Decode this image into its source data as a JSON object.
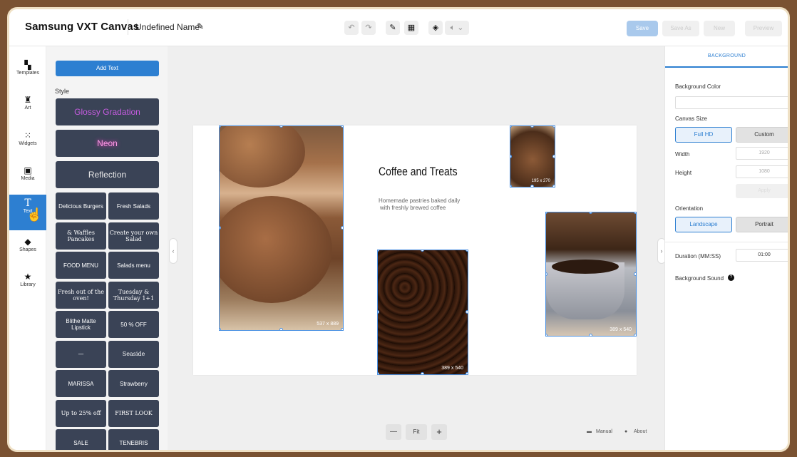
{
  "header": {
    "brand": "Samsung VXT Canvas",
    "project_name": "Undefined Name",
    "buttons": {
      "save": "Save",
      "save_as": "Save As",
      "new": "New",
      "preview": "Preview"
    }
  },
  "colors": {
    "accent": "#2d7fd1",
    "card_bg": "#3a4356",
    "frame": "#7a5232"
  },
  "icons": [
    "undo-icon",
    "redo-icon",
    "mode-edit-icon",
    "layout-icon",
    "layers-icon",
    "volume-icon",
    "pencil-icon"
  ],
  "nav": [
    {
      "label": "Templates"
    },
    {
      "label": "Art"
    },
    {
      "label": "Widgets"
    },
    {
      "label": "Media"
    },
    {
      "label": "Text"
    },
    {
      "label": "Shapes"
    },
    {
      "label": "Library"
    }
  ],
  "panel": {
    "add_text": "Add Text",
    "style_label": "Style",
    "styles_full": [
      "Glossy Gradation",
      "Neon",
      "Reflection"
    ],
    "styles_half": [
      [
        "Delicious Burgers",
        "Fresh Salads"
      ],
      [
        "& Waffles Pancakes",
        "Create your own Salad"
      ],
      [
        "FOOD MENU",
        "Salads menu"
      ],
      [
        "Fresh out of the oven!",
        "Tuesday & Thursday 1+1"
      ],
      [
        "Blithe Matte Lipstick",
        "50 % OFF"
      ],
      [
        "—",
        "Seaside"
      ],
      [
        "MARISSA",
        "Strawberry"
      ],
      [
        "Up to 25% off",
        "FIRST LOOK"
      ],
      [
        "SALE",
        "TENEBRIS"
      ]
    ]
  },
  "canvas": {
    "heading": "Coffee and Treats",
    "subtext1": "Homemade pastries baked daily",
    "subtext2": "with freshly brewed coffee",
    "size_muffin": "537 x 889",
    "size_small": "195 x 270",
    "size_beans": "389 x 540",
    "size_cup": "389 x 540"
  },
  "zoom": {
    "fit": "Fit",
    "minus": "—",
    "plus": "+"
  },
  "footer": {
    "manual": "Manual",
    "about": "About"
  },
  "right": {
    "tab": "BACKGROUND",
    "bg_color_label": "Background Color",
    "canvas_size_label": "Canvas Size",
    "full_hd": "Full HD",
    "custom": "Custom",
    "width_label": "Width",
    "width_value": "1920",
    "height_label": "Height",
    "height_value": "1080",
    "apply": "Apply",
    "orientation_label": "Orientation",
    "landscape": "Landscape",
    "portrait": "Portrait",
    "duration_label": "Duration (MM:SS)",
    "duration_value": "01:00",
    "bg_sound_label": "Background Sound"
  }
}
